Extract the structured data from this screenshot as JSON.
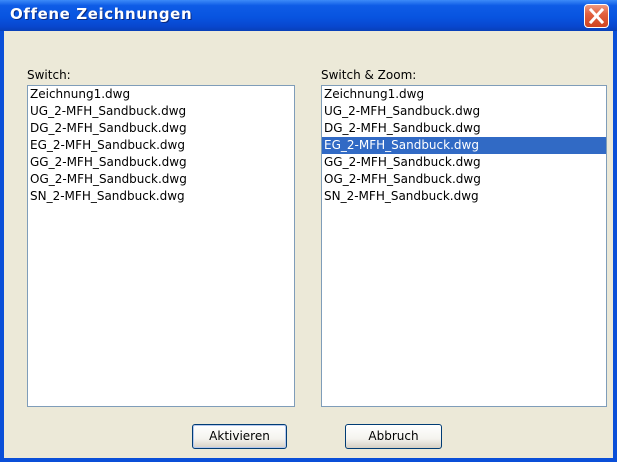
{
  "window": {
    "title": "Offene Zeichnungen",
    "close_icon": "close-icon"
  },
  "switch": {
    "label": "Switch:",
    "items": [
      "Zeichnung1.dwg",
      "UG_2-MFH_Sandbuck.dwg",
      "DG_2-MFH_Sandbuck.dwg",
      "EG_2-MFH_Sandbuck.dwg",
      "GG_2-MFH_Sandbuck.dwg",
      "OG_2-MFH_Sandbuck.dwg",
      "SN_2-MFH_Sandbuck.dwg"
    ]
  },
  "switch_zoom": {
    "label": "Switch & Zoom:",
    "selected": "EG_2-MFH_Sandbuck.dwg",
    "items": [
      "Zeichnung1.dwg",
      "UG_2-MFH_Sandbuck.dwg",
      "DG_2-MFH_Sandbuck.dwg",
      "EG_2-MFH_Sandbuck.dwg",
      "GG_2-MFH_Sandbuck.dwg",
      "OG_2-MFH_Sandbuck.dwg",
      "SN_2-MFH_Sandbuck.dwg"
    ]
  },
  "buttons": {
    "activate": "Aktivieren",
    "cancel": "Abbruch"
  },
  "colors": {
    "titlebar": "#0854e0",
    "selection": "#316ac5",
    "dialog_background": "#ece9d8"
  }
}
